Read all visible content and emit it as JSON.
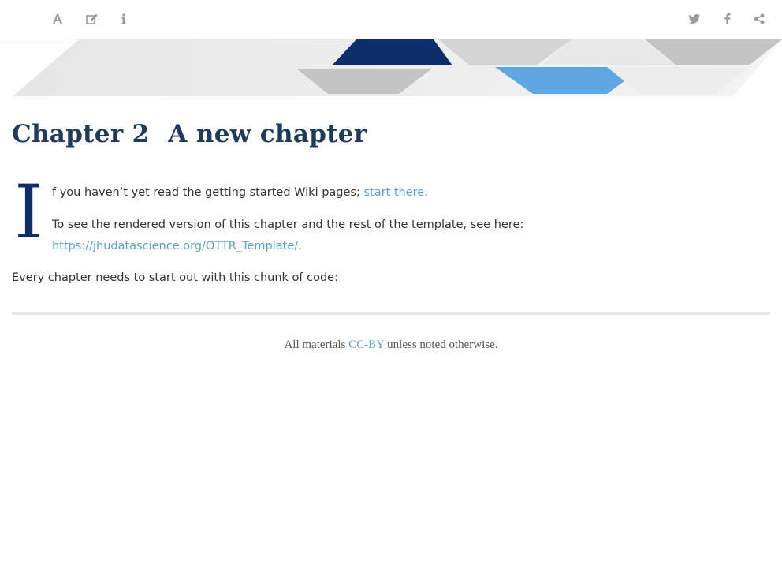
{
  "toolbar": {
    "left_icons": [
      "font-settings-icon",
      "edit-icon",
      "info-icon"
    ],
    "right_icons": [
      "twitter-icon",
      "facebook-icon",
      "share-icon"
    ],
    "icon_color": "#9a9a9a"
  },
  "banner": {
    "colors": {
      "navy": "#0d2d6b",
      "light_blue": "#5fa7e3",
      "gray": "#c4c4c4",
      "light_gray": "#e3e3e3"
    }
  },
  "chapter": {
    "number": "Chapter 2",
    "title": "A new chapter"
  },
  "content": {
    "dropcap": "I",
    "p1_text": "f you haven’t yet read the getting started Wiki pages; ",
    "p1_link": "start there",
    "p1_end": ".",
    "p2_line1": "To see the rendered version of this chapter and the rest of the template, see here:",
    "p2_link": "https://jhudatascience.org/OTTR_Template/",
    "p2_end": ".",
    "p3_text": "Every chapter needs to start out with this chunk of code:"
  },
  "footer": {
    "prefix": "All materials ",
    "link": "CC-BY",
    "suffix": " unless noted otherwise."
  },
  "colors": {
    "link": "#5aa0d6",
    "title": "#1e3a5f",
    "dropcap": "#0d2d6b"
  }
}
